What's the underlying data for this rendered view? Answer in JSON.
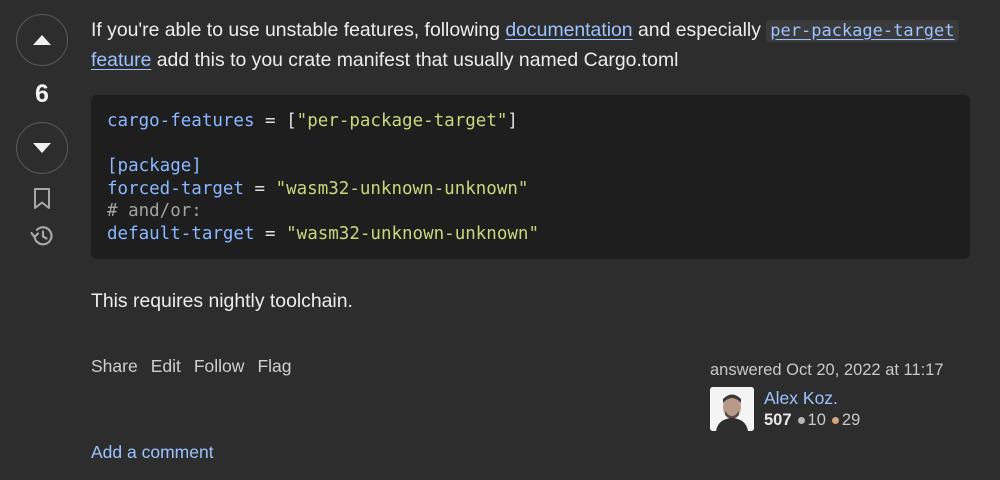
{
  "vote": {
    "count": "6",
    "upvote_icon": "triangle-up-icon",
    "downvote_icon": "triangle-down-icon",
    "bookmark_icon": "bookmark-icon",
    "history_icon": "history-icon"
  },
  "post": {
    "p1_part1": "If you're able to use unstable features, following ",
    "p1_link_documentation": "documentation",
    "p1_part2": " and especially ",
    "p1_code_link": "per-package-target",
    "p1_link_feature": " feature",
    "p1_part3": " add this to you crate manifest that usually named Cargo.toml",
    "code": {
      "l1_key": "cargo-features",
      "l1_op": " = [",
      "l1_str": "\"per-package-target\"",
      "l1_end": "]",
      "l3_section": "[package]",
      "l4_key": "forced-target",
      "l4_op": " = ",
      "l4_str": "\"wasm32-unknown-unknown\"",
      "l5_comment": "# and/or:",
      "l6_key": "default-target",
      "l6_op": " = ",
      "l6_str": "\"wasm32-unknown-unknown\""
    },
    "p2": "This requires nightly toolchain."
  },
  "actions": {
    "share": "Share",
    "edit": "Edit",
    "follow": "Follow",
    "flag": "Flag"
  },
  "author": {
    "answered": "answered Oct 20, 2022 at 11:17",
    "name": "Alex Koz.",
    "reputation": "507",
    "silver_badges": "10",
    "bronze_badges": "29"
  },
  "comments": {
    "add_label": "Add a comment"
  },
  "colors": {
    "background": "#2d2d2d",
    "code_bg": "#1e1e1e",
    "link": "#9cc3ff",
    "string": "#c6d97b",
    "key": "#8ab7ff"
  }
}
